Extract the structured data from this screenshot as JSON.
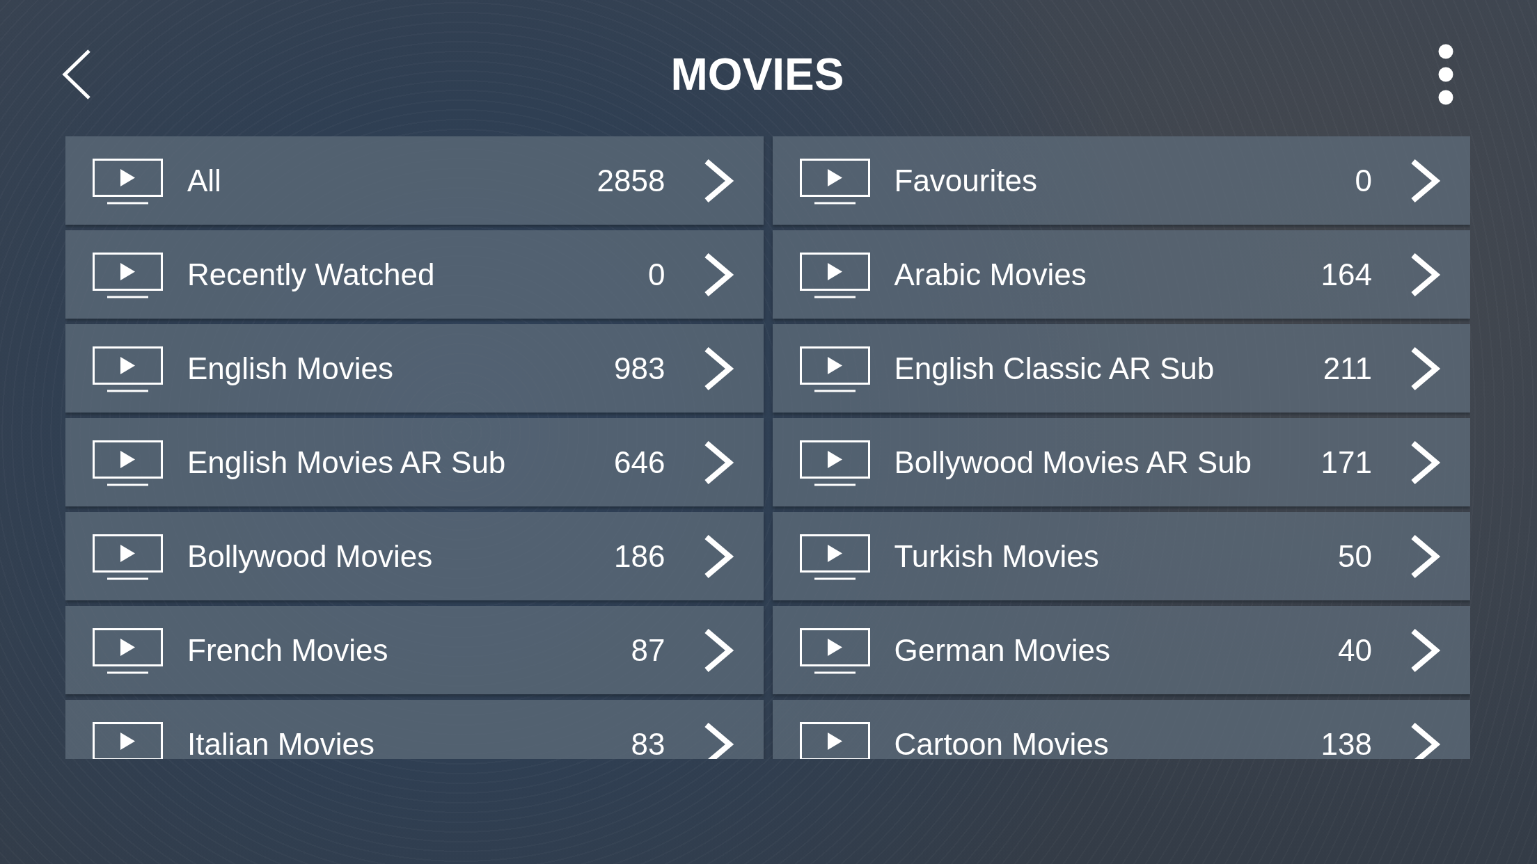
{
  "header": {
    "title": "MOVIES"
  },
  "categories": [
    {
      "label": "All",
      "count": "2858"
    },
    {
      "label": "Favourites",
      "count": "0"
    },
    {
      "label": "Recently Watched",
      "count": "0"
    },
    {
      "label": "Arabic Movies",
      "count": "164"
    },
    {
      "label": "English Movies",
      "count": "983"
    },
    {
      "label": "English Classic AR Sub",
      "count": "211"
    },
    {
      "label": "English Movies AR Sub",
      "count": "646"
    },
    {
      "label": "Bollywood Movies AR Sub",
      "count": "171"
    },
    {
      "label": "Bollywood Movies",
      "count": "186"
    },
    {
      "label": "Turkish Movies",
      "count": "50"
    },
    {
      "label": "French Movies",
      "count": "87"
    },
    {
      "label": "German Movies",
      "count": "40"
    },
    {
      "label": "Italian Movies",
      "count": "83"
    },
    {
      "label": "Cartoon Movies",
      "count": "138"
    }
  ]
}
